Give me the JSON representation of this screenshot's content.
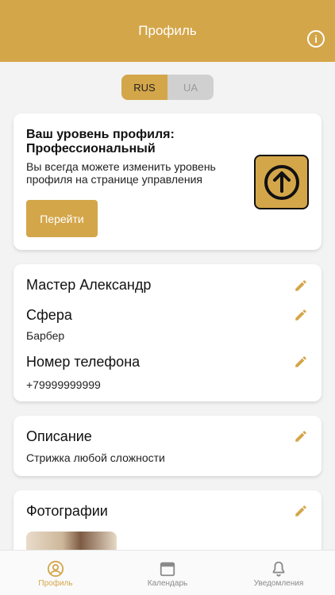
{
  "header": {
    "title": "Профиль",
    "info_icon": "info-icon"
  },
  "language": {
    "options": [
      "RUS",
      "UA"
    ],
    "selected": "RUS"
  },
  "level_card": {
    "title": "Ваш уровень профиля: Профессиональный",
    "description": "Вы всегда можете изменить уровень профиля на странице управления",
    "button_label": "Перейти",
    "icon": "arrow-up-icon"
  },
  "profile_card": {
    "name": "Мастер Александр",
    "sphere_label": "Сфера",
    "sphere_value": "Барбер",
    "phone_label": "Номер телефона",
    "phone_value": "+79999999999"
  },
  "description_card": {
    "label": "Описание",
    "value": "Стрижка любой сложности"
  },
  "photos_card": {
    "label": "Фотографии"
  },
  "tabbar": {
    "items": [
      {
        "label": "Профиль",
        "icon": "profile-icon",
        "active": true
      },
      {
        "label": "Календарь",
        "icon": "calendar-icon",
        "active": false
      },
      {
        "label": "Уведомления",
        "icon": "bell-icon",
        "active": false
      }
    ]
  },
  "colors": {
    "accent": "#d4a64a",
    "background": "#f3f3f3",
    "toggle_inactive": "#d0d0d0"
  }
}
